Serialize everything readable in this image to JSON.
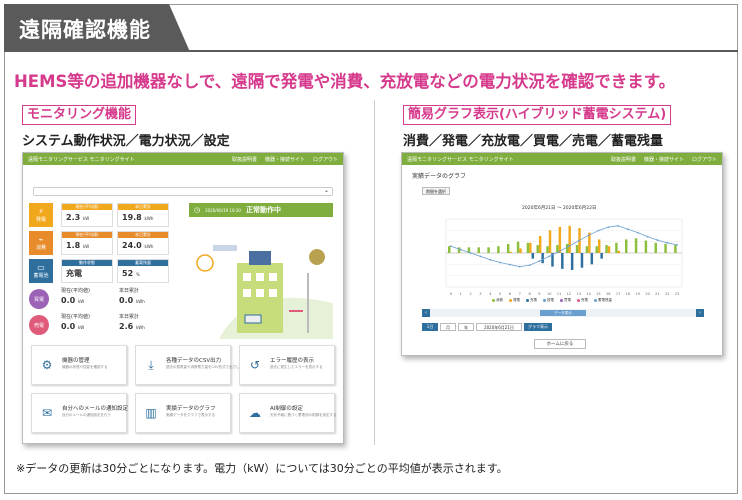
{
  "title": "遠隔確認機能",
  "headline": "HEMS等の追加機器なしで、遠隔で発電や消費、充放電などの電力状況を確認できます。",
  "left": {
    "label": "モニタリング機能",
    "subtitle": "システム動作状況／電力状況／設定"
  },
  "right": {
    "label": "簡易グラフ表示(ハイブリッド蓄電システム)",
    "subtitle": "消費／発電／充放電／買電／売電／蓄電残量"
  },
  "footnote": "※データの更新は30分ごとになります。電力（kW）については30分ごとの平均値が表示されます。",
  "colors": {
    "accent": "#d63a8c",
    "header_bar": "#7fae3f",
    "consume": "#8bbf3c",
    "gen": "#f2a81d",
    "battery": "#2e6f9e",
    "buy": "#9c62b5",
    "sell": "#e05a7a"
  },
  "monitor": {
    "app_title": "遠隔モニタリングサービス",
    "app_sub": "モニタリングサイト",
    "nav": [
      "取扱説明書",
      "機器・接続サイト",
      "ログアウト"
    ],
    "status_date": "2020/06/19 10:30",
    "status_text": "正常動作中",
    "rows": [
      {
        "icon_label": "発電",
        "c1_head": "現在(平均値)",
        "c1_val": "2.3",
        "c1_unit": "kW",
        "c2_head": "本日累計",
        "c2_val": "19.8",
        "c2_unit": "kWh"
      },
      {
        "icon_label": "消費",
        "c1_head": "現在(平均値)",
        "c1_val": "1.8",
        "c1_unit": "kW",
        "c2_head": "本日累計",
        "c2_val": "24.0",
        "c2_unit": "kWh"
      },
      {
        "icon_label": "蓄電池",
        "c1_head": "動作状態",
        "c1_val": "充電",
        "c1_unit": "",
        "c2_head": "蓄電残量",
        "c2_val": "52",
        "c2_unit": "%"
      }
    ],
    "buy": {
      "icon_label": "買電",
      "h1": "現在(平均値)",
      "v1": "0.0",
      "u1": "kW",
      "h2": "本日累計",
      "v2": "0.0",
      "u2": "kWh"
    },
    "sell": {
      "icon_label": "売電",
      "h1": "現在(平均値)",
      "v1": "0.0",
      "u1": "kW",
      "h2": "本日累計",
      "v2": "2.6",
      "u2": "kWh"
    },
    "tiles": [
      {
        "title": "機器の管理",
        "desc": "機器の状態や性能を確認する"
      },
      {
        "title": "各種データのCSV出力",
        "desc": "過去の発電量や消費電力量をCSV形式で出力します"
      },
      {
        "title": "エラー履歴の表示",
        "desc": "過去に発生したエラーを表示する"
      },
      {
        "title": "自分へのメールの通知設定",
        "desc": "自分のメールの通知設定を行う"
      },
      {
        "title": "実績データのグラフ",
        "desc": "実績データをグラフで表示する"
      },
      {
        "title": "AI制御の設定",
        "desc": "天気予報に基づく蓄電池の制御を設定する"
      }
    ]
  },
  "graph": {
    "app_title": "遠隔モニタリングサービス",
    "app_sub": "モニタリングサイト",
    "nav": [
      "取扱説明書",
      "機器・接続サイト",
      "ログアウト"
    ],
    "page_title": "実績データのグラフ",
    "period_button": "期間を選択",
    "range": "2020年6月21日 ～ 2020年6月22日",
    "legend": [
      "消費",
      "発電",
      "充電",
      "放電",
      "買電",
      "売電",
      "蓄電残量"
    ],
    "back_button": "ホームに戻る",
    "scroll_button": "データ表示",
    "tabs": [
      "1日",
      "月",
      "年"
    ],
    "date_input": "2020年6月21日",
    "csv_button": "グラフ表示"
  },
  "chart_data": {
    "type": "bar",
    "title": "2020年6月21日 ～ 2020年6月22日",
    "x": [
      "0",
      "1",
      "2",
      "3",
      "4",
      "5",
      "6",
      "7",
      "8",
      "9",
      "10",
      "11",
      "12",
      "13",
      "14",
      "15",
      "16",
      "17",
      "18",
      "19",
      "20",
      "21",
      "22",
      "23"
    ],
    "series": [
      {
        "name": "消費",
        "values": [
          0.6,
          0.5,
          0.5,
          0.5,
          0.5,
          0.6,
          0.8,
          1.0,
          0.9,
          0.7,
          0.6,
          0.7,
          0.8,
          0.7,
          0.6,
          0.6,
          0.7,
          0.9,
          1.2,
          1.3,
          1.1,
          0.9,
          0.8,
          0.7
        ]
      },
      {
        "name": "発電",
        "values": [
          0,
          0,
          0,
          0,
          0,
          0,
          0.1,
          0.4,
          0.9,
          1.5,
          2.0,
          2.3,
          2.4,
          2.2,
          1.8,
          1.2,
          0.6,
          0.2,
          0,
          0,
          0,
          0,
          0,
          0
        ]
      },
      {
        "name": "充電",
        "values": [
          0,
          0,
          0,
          0,
          0,
          0,
          0,
          0,
          0.5,
          0.9,
          1.2,
          1.4,
          1.5,
          1.3,
          1.0,
          0.5,
          0,
          0,
          0,
          0,
          0,
          0,
          0,
          0
        ]
      },
      {
        "name": "蓄電残量",
        "values": [
          60,
          55,
          50,
          45,
          40,
          36,
          33,
          30,
          32,
          38,
          45,
          52,
          60,
          68,
          76,
          83,
          88,
          90,
          85,
          80,
          74,
          69,
          65,
          62
        ]
      }
    ],
    "ylim": [
      -3,
      3
    ]
  }
}
